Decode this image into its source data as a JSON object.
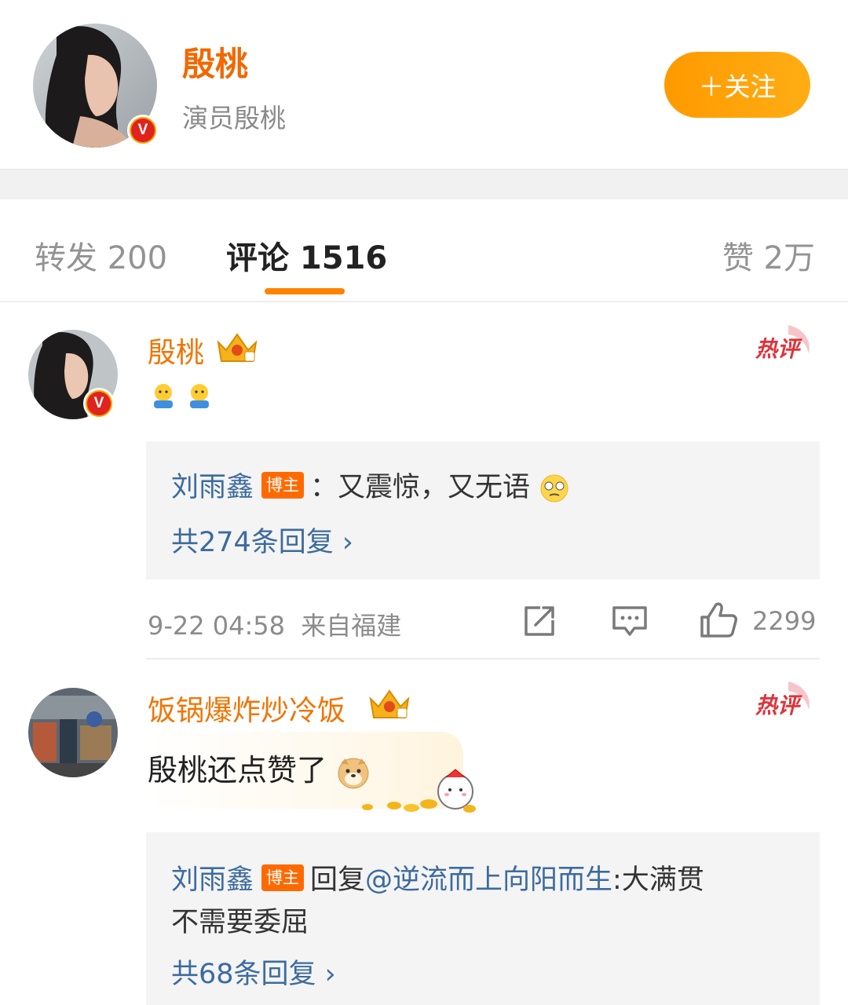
{
  "header": {
    "name": "殷桃",
    "subtitle": "演员殷桃",
    "follow_label": "＋关注"
  },
  "tabs": {
    "repost": "转发 200",
    "comment": "评论 1516",
    "like": "赞 2万"
  },
  "comments": [
    {
      "author": "殷桃",
      "hot_label": "热评",
      "reply": {
        "author": "刘雨鑫",
        "tag": "博主",
        "text": "：又震惊，又无语",
        "more": "共274条回复 ›"
      },
      "time": "9-22 04:58",
      "location": "来自福建",
      "likes": "2299"
    },
    {
      "author": "饭锅爆炸炒冷饭",
      "hot_label": "热评",
      "text": "殷桃还点赞了",
      "reply": {
        "author": "刘雨鑫",
        "tag": "博主",
        "reply_word": "回复",
        "mention": "@逆流而上向阳而生",
        "text_line1": ":大满贯",
        "text_line2": "不需要委屈",
        "more": "共68条回复 ›"
      }
    }
  ],
  "colors": {
    "accent": "#ff8200",
    "name_orange": "#f17400",
    "link_blue": "#3c6b9e",
    "verified_red": "#e0231e"
  }
}
